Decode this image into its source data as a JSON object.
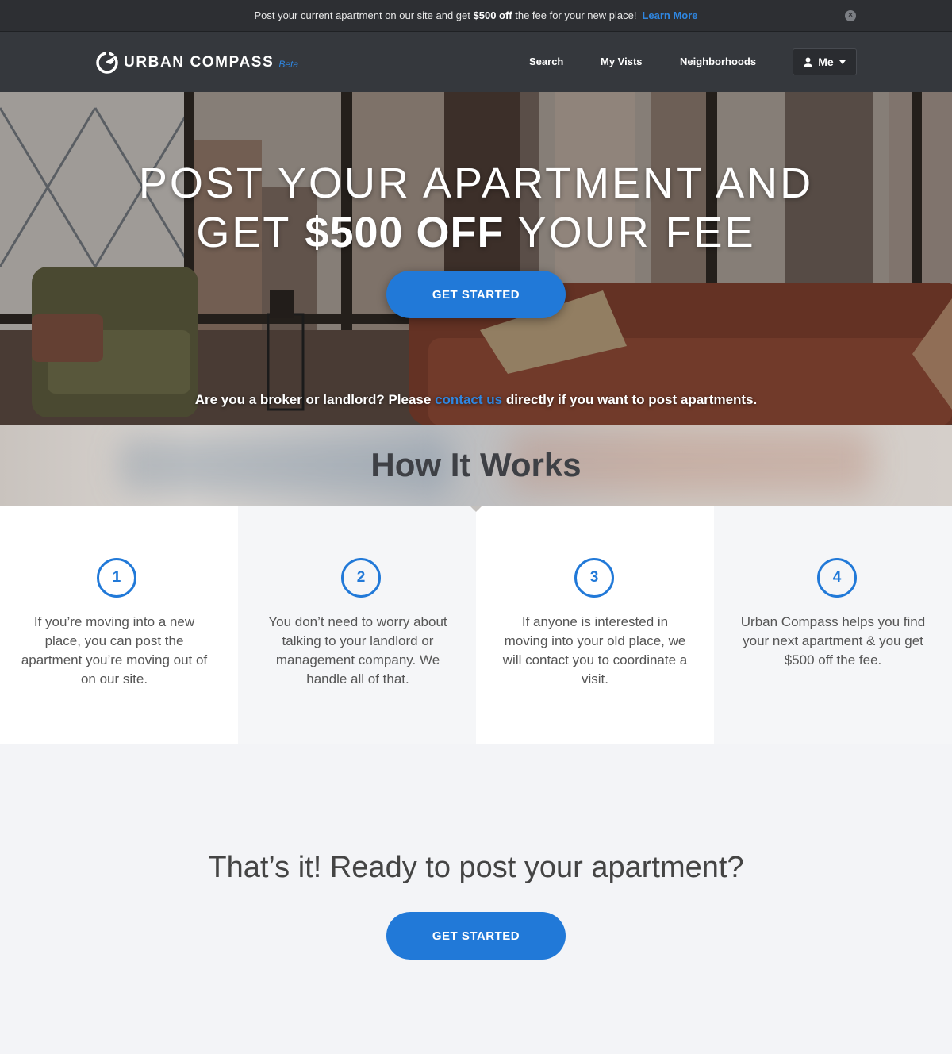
{
  "promo": {
    "text_before": "Post your current apartment on our site and get ",
    "text_bold": "$500 off",
    "text_after": " the fee for your new place!",
    "learn_more": "Learn More",
    "close_icon": "close-icon"
  },
  "nav": {
    "brand": "URBAN COMPASS",
    "beta": "Beta",
    "logo_icon": "compass-icon",
    "links": [
      "Search",
      "My Vists",
      "Neighborhoods"
    ],
    "me_label": "Me",
    "user_icon": "user-icon",
    "caret_icon": "caret-down-icon"
  },
  "hero": {
    "line1": "POST YOUR APARTMENT AND",
    "line2_before": "GET ",
    "line2_bold": "$500 OFF",
    "line2_after": " YOUR FEE",
    "cta": "GET STARTED",
    "broker_before": "Are you a broker or landlord? Please ",
    "broker_link": "contact us",
    "broker_after": " directly if you want to post apartments."
  },
  "how": {
    "title": "How It Works",
    "steps": [
      {
        "number": "1",
        "text": "If you’re moving into a new place, you can post the apartment you’re moving out of on our site."
      },
      {
        "number": "2",
        "text": "You don’t need to worry about talking to your landlord or management company. We handle all of that."
      },
      {
        "number": "3",
        "text": "If anyone is interested in moving into your old place, we will contact you to coordinate a visit."
      },
      {
        "number": "4",
        "text": "Urban Compass helps you find your next apartment & you get $500 off the fee."
      }
    ]
  },
  "cta": {
    "title": "That’s it! Ready to post your apartment?",
    "button": "GET STARTED"
  },
  "colors": {
    "accent": "#2179d8",
    "nav_bg": "#35383d",
    "promo_bg": "#2d2f33"
  }
}
